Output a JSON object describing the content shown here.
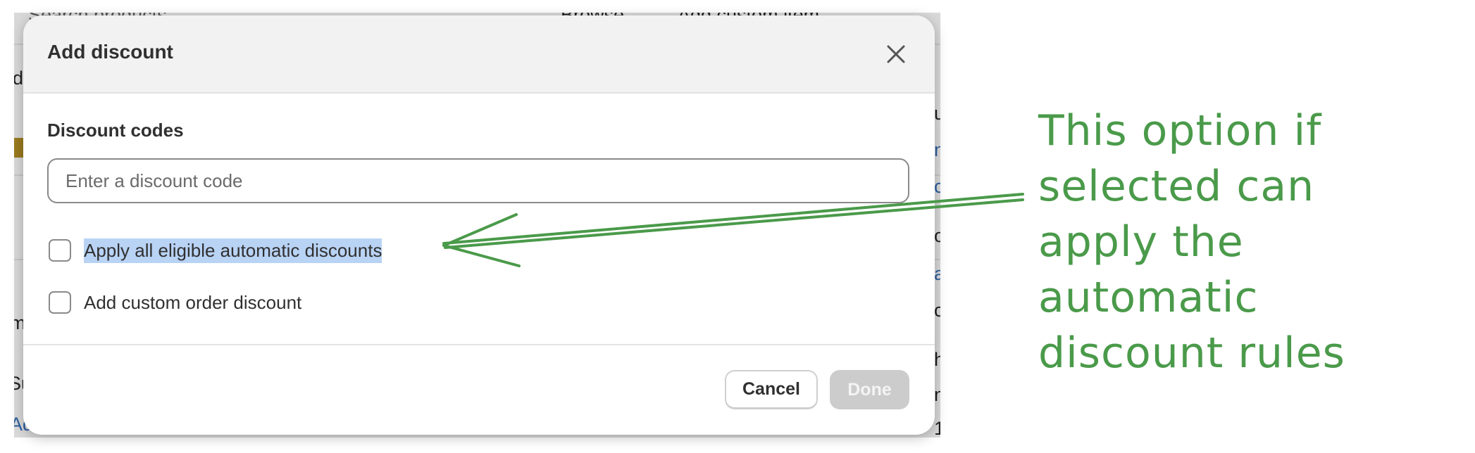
{
  "background_app": {
    "top_search_fragment": "Search products",
    "top_browse": "Browse",
    "top_add_custom": "Add custom item",
    "left_fragments": [
      "d",
      "m",
      "Su",
      "Ad"
    ],
    "right_fragments": [
      "u",
      "n",
      "c",
      "o",
      "a",
      "c",
      "h",
      "n",
      "1"
    ]
  },
  "modal": {
    "title": "Add discount",
    "close_icon": "close-icon",
    "codes_label": "Discount codes",
    "code_input": {
      "value": "",
      "placeholder": "Enter a discount code"
    },
    "options": [
      {
        "label": "Apply all eligible automatic discounts",
        "checked": false,
        "highlighted": true
      },
      {
        "label": "Add custom order discount",
        "checked": false,
        "highlighted": false
      }
    ],
    "cancel_label": "Cancel",
    "done_label": "Done"
  },
  "annotation": {
    "text": "This option if\nselected can\napply the\nautomatic\ndiscount rules",
    "color": "#4a9a4a"
  }
}
